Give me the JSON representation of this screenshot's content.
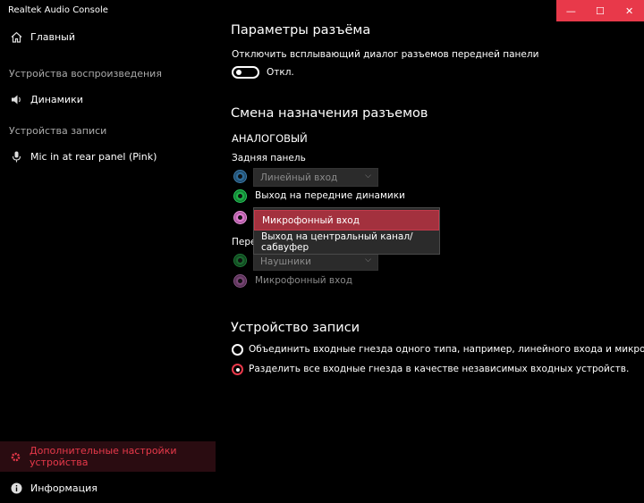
{
  "window": {
    "title": "Realtek Audio Console",
    "controls": {
      "minimize": "—",
      "maximize": "☐",
      "close": "✕"
    },
    "accent": "#e8394a"
  },
  "sidebar": {
    "home": {
      "label": "Главный",
      "icon": "home-icon"
    },
    "playback_section": "Устройства воспроизведения",
    "speakers": {
      "label": "Динамики",
      "icon": "speaker-icon"
    },
    "recording_section": "Устройства записи",
    "mic": {
      "label": "Mic in at rear panel (Pink)",
      "icon": "microphone-icon"
    },
    "advanced": {
      "label": "Дополнительные настройки устройства",
      "icon": "gear-icon"
    },
    "info": {
      "label": "Информация",
      "icon": "info-icon"
    }
  },
  "main": {
    "connector_title": "Параметры разъёма",
    "disable_popup_label": "Отключить всплывающий диалог разъемов передней панели",
    "toggle_state": "Откл.",
    "reassign_title": "Смена назначения разъемов",
    "analog_label": "АНАЛОГОВЫЙ",
    "rear_panel_label": "Задняя панель",
    "rear_jack1_select": "Линейный вход",
    "rear_jack2_label": "Выход на передние динамики",
    "front_panel_label_partial": "Пере",
    "front_jack1_select": "Наушники",
    "front_jack2_label": "Микрофонный вход",
    "dropdown": {
      "options": [
        "Микрофонный вход",
        "Выход на центральный канал/сабвуфер"
      ],
      "selected": "Микрофонный вход"
    },
    "recording_device_title": "Устройство записи",
    "radio_combine": "Объединить входные гнезда одного типа, например, линейного входа и микрофона в каче",
    "radio_separate": "Разделить все входные гнезда в качестве независимых входных устройств.",
    "radio_selected": "separate"
  }
}
